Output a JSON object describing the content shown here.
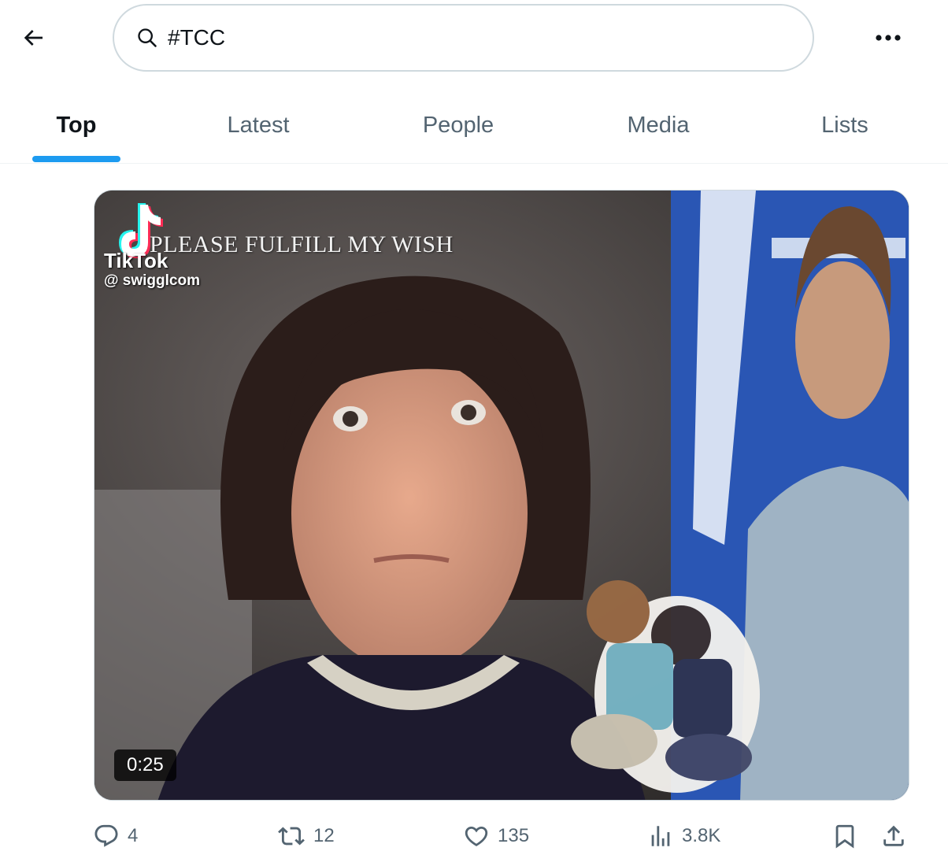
{
  "search": {
    "query": "#TCC",
    "placeholder": "Search"
  },
  "header": {
    "back_icon": "arrow-left-icon",
    "more_icon": "more-dots-icon"
  },
  "tabs": [
    {
      "label": "Top",
      "active": true
    },
    {
      "label": "Latest",
      "active": false
    },
    {
      "label": "People",
      "active": false
    },
    {
      "label": "Media",
      "active": false
    },
    {
      "label": "Lists",
      "active": false
    }
  ],
  "post": {
    "media": {
      "watermark_brand": "TikTok",
      "watermark_handle": "@ swigglcom",
      "caption": "PLEASE FULFILL MY WISH",
      "duration": "0:25"
    },
    "actions": {
      "replies": "4",
      "reposts": "12",
      "likes": "135",
      "views": "3.8K"
    }
  },
  "colors": {
    "accent": "#1d9bf0",
    "secondary_text": "#536471",
    "border": "#cfd9de"
  }
}
